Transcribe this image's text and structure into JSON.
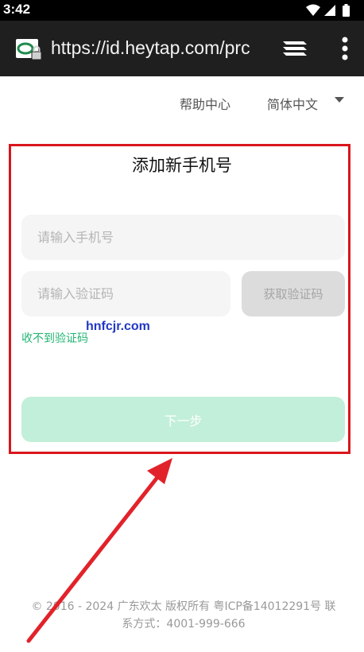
{
  "status_bar": {
    "time": "3:42",
    "icons": [
      "wifi-icon",
      "signal-icon",
      "battery-icon"
    ]
  },
  "browser": {
    "url": "https://id.heytap.com/prc",
    "icons": [
      "site-security-icon",
      "tabs-icon",
      "menu-icon"
    ]
  },
  "nav": {
    "help": "帮助中心",
    "language": "简体中文"
  },
  "form": {
    "title": "添加新手机号",
    "phone_placeholder": "请输入手机号",
    "code_placeholder": "请输入验证码",
    "get_code_label": "获取验证码",
    "no_code_link": "收不到验证码",
    "next_label": "下一步"
  },
  "watermark": "hnfcjr.com",
  "footer": {
    "line1": "© 2016 - 2024 广东欢太 版权所有 粤ICP备14012291号 联",
    "line2": "系方式：4001-999-666"
  },
  "colors": {
    "accent_green": "#22b573",
    "next_button_bg": "#c2efd9",
    "highlight_red": "#d9161c",
    "browser_bar": "#1f1f1f"
  }
}
